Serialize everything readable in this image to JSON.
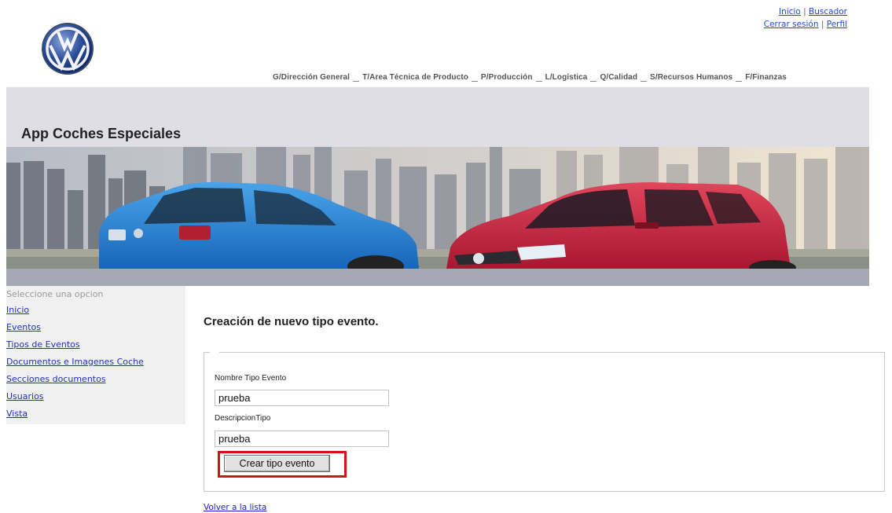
{
  "header": {
    "top_links": {
      "inicio": "Inicio",
      "separator": "|",
      "buscador": "Buscador",
      "cerrar_sesion": "Cerrar sesión",
      "perfil": "Perfil"
    },
    "nav": [
      "G/Dirección General",
      "T/Area Técnica de Producto",
      "P/Producción",
      "L/Logística",
      "Q/Calidad",
      "S/Recursos Humanos",
      "F/Finanzas"
    ]
  },
  "banner": {
    "app_title": "App Coches Especiales"
  },
  "sidebar": {
    "title": "Seleccione una opcion",
    "items": [
      "Inicio",
      "Eventos",
      "Tipos de Eventos",
      "Documentos e Imagenes Coche",
      "Secciones documentos",
      "Usuarios",
      "Vista"
    ]
  },
  "main": {
    "title": "Creación de nuevo tipo evento.",
    "form": {
      "nombre_label": "Nombre Tipo Evento",
      "nombre_value": "prueba",
      "desc_label": "DescripcionTipo",
      "desc_value": "prueba",
      "submit_label": "Crear tipo evento"
    },
    "back_link": "Volver a la lista"
  },
  "colors": {
    "link": "#1a1acc",
    "highlight": "#dd1010",
    "banner_bg": "#dedee4",
    "banner_strip": "#a6a8b4",
    "car_blue": "#1e7fd0",
    "car_red": "#c8203a"
  },
  "icons": {
    "logo": "vw-logo-icon"
  }
}
